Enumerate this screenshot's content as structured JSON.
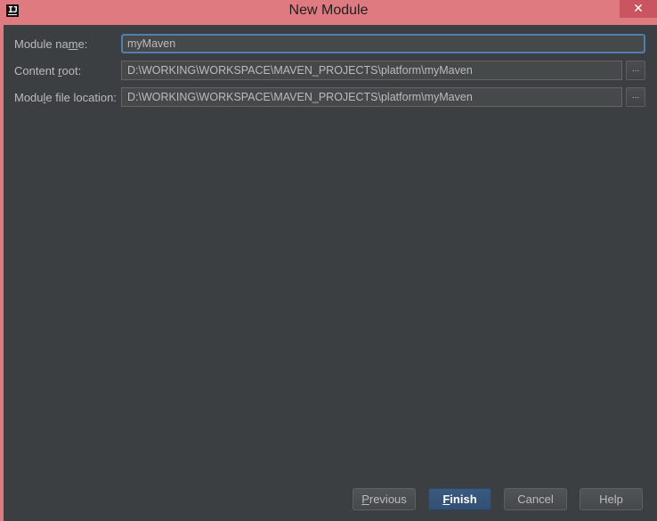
{
  "window": {
    "title": "New Module",
    "app_icon_text": "IJ",
    "close_glyph": "✕"
  },
  "form": {
    "module_name": {
      "label_pre": "Module na",
      "label_mn": "m",
      "label_post": "e:",
      "value": "myMaven"
    },
    "content_root": {
      "label_pre": "Content ",
      "label_mn": "r",
      "label_post": "oot:",
      "value": "D:\\WORKING\\WORKSPACE\\MAVEN_PROJECTS\\platform\\myMaven"
    },
    "module_file_location": {
      "label_pre": "Modu",
      "label_mn": "l",
      "label_post": "e file location:",
      "value": "D:\\WORKING\\WORKSPACE\\MAVEN_PROJECTS\\platform\\myMaven"
    },
    "browse_label": "..."
  },
  "buttons": {
    "previous": {
      "mn": "P",
      "rest": "revious"
    },
    "finish": {
      "mn": "F",
      "rest": "inish"
    },
    "cancel": {
      "label": "Cancel"
    },
    "help": {
      "label": "Help"
    }
  },
  "colors": {
    "titlebar": "#df7b80",
    "panel": "#3c3f41",
    "field_bg": "#45494a",
    "focus_border": "#4f7fb0",
    "primary_button": "#365880"
  }
}
